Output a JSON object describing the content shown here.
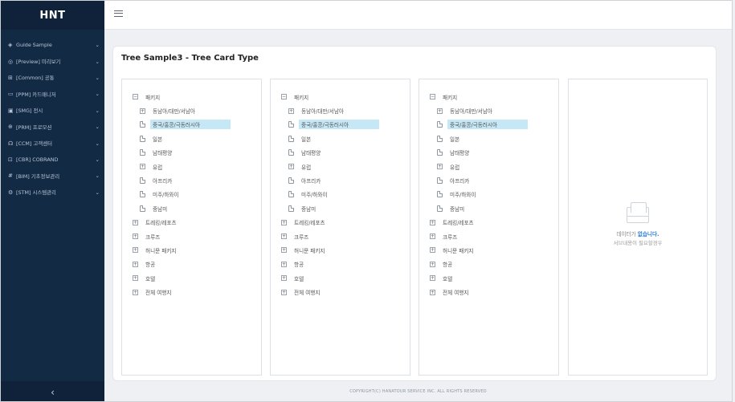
{
  "brand": "HNT",
  "sidebar": {
    "items": [
      {
        "icon": "◈",
        "label": "Guide Sample"
      },
      {
        "icon": "◎",
        "label": "[Preview] 미리보기"
      },
      {
        "icon": "⊞",
        "label": "[Common] 공통"
      },
      {
        "icon": "▭",
        "label": "[PPM] 카드매니저"
      },
      {
        "icon": "▣",
        "label": "[SMG] 전시"
      },
      {
        "icon": "⊕",
        "label": "[PRM] 프로모션"
      },
      {
        "icon": "☊",
        "label": "[CCM] 고객센터"
      },
      {
        "icon": "⊡",
        "label": "[CBR] COBRAND"
      },
      {
        "icon": "#",
        "label": "[BIM] 기초정보관리"
      },
      {
        "icon": "⚙",
        "label": "[STM] 시스템관리"
      }
    ],
    "chevron": "⌄",
    "collapse": "‹"
  },
  "card": {
    "title": "Tree Sample3 - Tree Card Type"
  },
  "tree": {
    "nodes": [
      {
        "label": "패키지",
        "level": 0,
        "toggle": "−"
      },
      {
        "label": "동남아/대만/서남아",
        "level": 1,
        "toggle": "+"
      },
      {
        "label": "중국/홍콩/극동러시아",
        "level": 1,
        "leaf": true,
        "selected": true
      },
      {
        "label": "일본",
        "level": 1,
        "leaf": true
      },
      {
        "label": "남태평양",
        "level": 1,
        "leaf": true
      },
      {
        "label": "유럽",
        "level": 1,
        "toggle": "+"
      },
      {
        "label": "아프리카",
        "level": 1,
        "leaf": true
      },
      {
        "label": "미주/하와이",
        "level": 1,
        "leaf": true
      },
      {
        "label": "중남미",
        "level": 1,
        "leaf": true
      },
      {
        "label": "트레킹/레포츠",
        "level": 0,
        "toggle": "+"
      },
      {
        "label": "크루즈",
        "level": 0,
        "toggle": "+"
      },
      {
        "label": "허니문 패키지",
        "level": 0,
        "toggle": "+"
      },
      {
        "label": "항공",
        "level": 0,
        "toggle": "+"
      },
      {
        "label": "호텔",
        "level": 0,
        "toggle": "+"
      },
      {
        "label": "전체 여행지",
        "level": 0,
        "toggle": "+"
      }
    ]
  },
  "empty_state": {
    "message_prefix": "데이터가 ",
    "message_highlight": "없습니다.",
    "sub": "서브내용이 필요할경우"
  },
  "footer": "COPYRIGHT(C) HANATOUR SERVICE INC. ALL RIGHTS RESERVED"
}
